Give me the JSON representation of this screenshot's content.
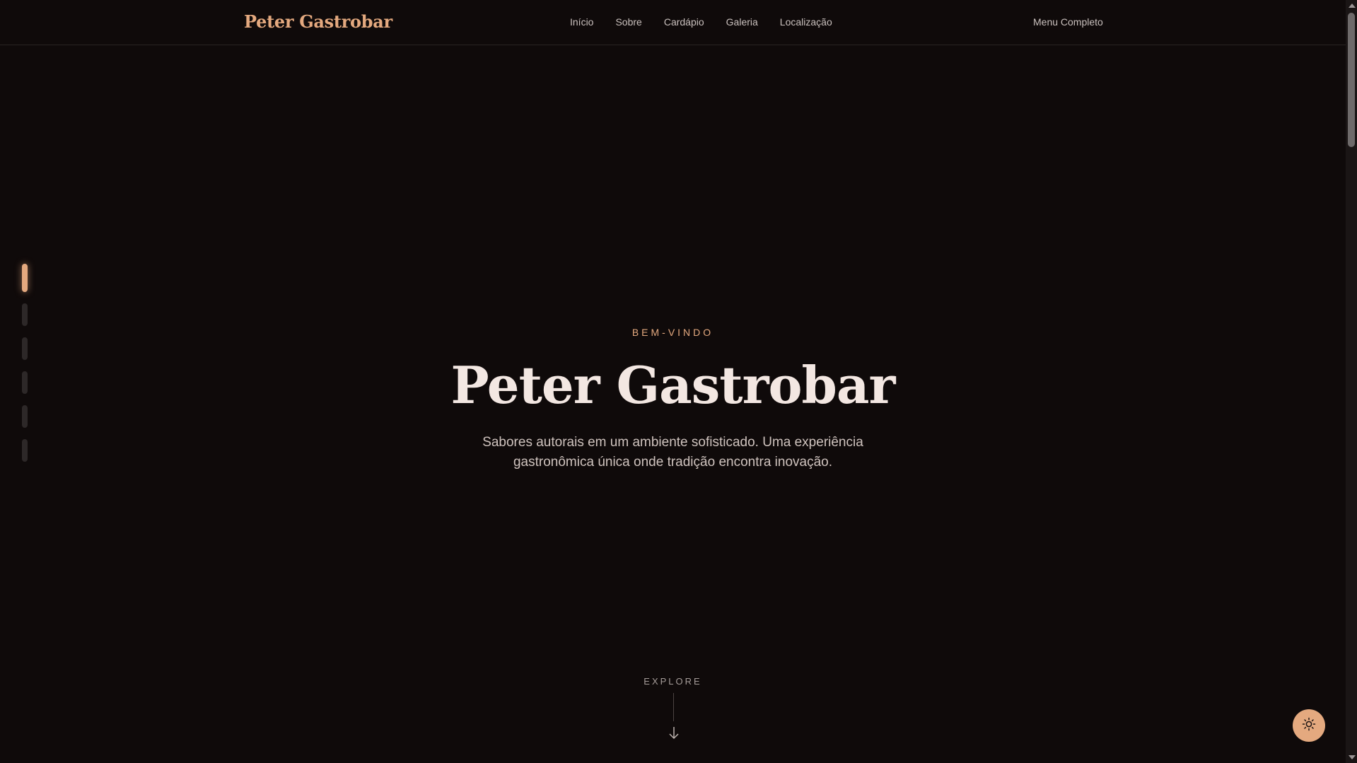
{
  "header": {
    "brand": "Peter Gastrobar",
    "nav": [
      "Início",
      "Sobre",
      "Cardápio",
      "Galeria",
      "Localização"
    ],
    "cta": "Menu Completo"
  },
  "hero": {
    "eyebrow": "BEM-VINDO",
    "title": "Peter Gastrobar",
    "subtitle": "Sabores autorais em um ambiente sofisticado. Uma experiência gastronômica única onde tradição encontra inovação."
  },
  "explore": {
    "label": "EXPLORE"
  },
  "indicators": {
    "count": 6,
    "active_index": 0
  },
  "colors": {
    "background": "#0f0a0a",
    "accent": "#e4a97f",
    "title": "#f3e7e2"
  },
  "icons": {
    "theme_toggle": "sun-icon",
    "explore": "arrow-down-icon"
  }
}
